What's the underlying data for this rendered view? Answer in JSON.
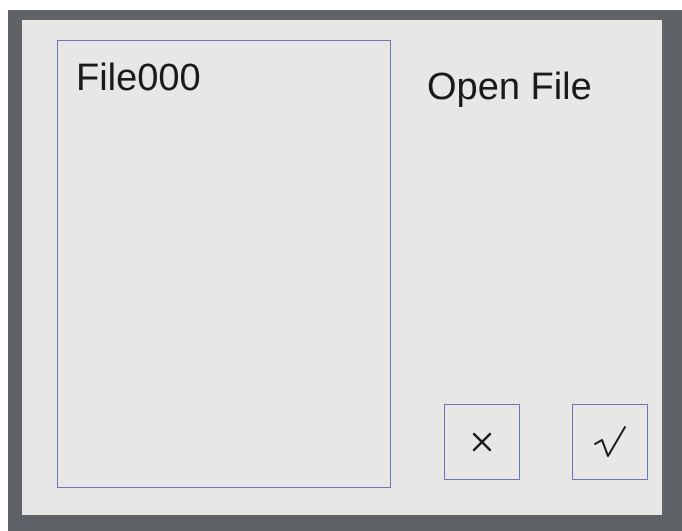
{
  "dialog": {
    "title": "Open File",
    "files": [
      "File000"
    ],
    "cancel_icon": "close-icon",
    "confirm_icon": "checkmark-icon"
  },
  "colors": {
    "frame": "#5f6368",
    "dialog_bg": "#e8e7e6",
    "border": "#6b77b8",
    "text": "#1a1a1a"
  }
}
